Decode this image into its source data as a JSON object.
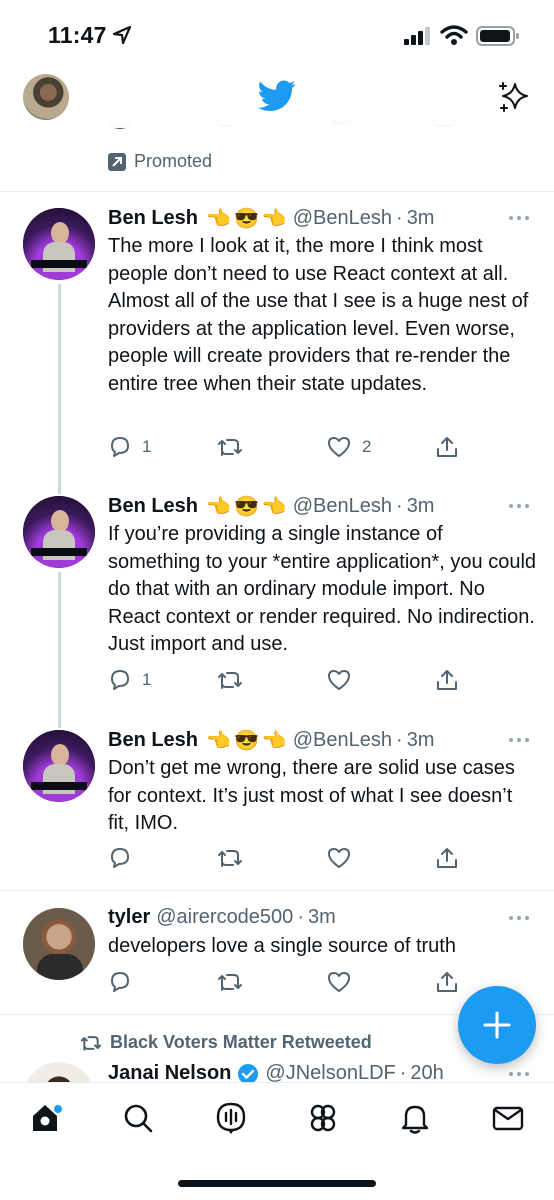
{
  "status": {
    "time": "11:47"
  },
  "promoted_label": "Promoted",
  "tweets": [
    {
      "name": "Ben Lesh",
      "emojis": [
        "👈",
        "😎",
        "👈"
      ],
      "handle": "@BenLesh",
      "time": "3m",
      "text": "The more I look at it, the more I think most people don’t need to use React context at all. Almost all of the use that I see is a huge nest of providers at the application level. Even worse, people will create providers that re-render the entire tree when their state updates.",
      "replies": "1",
      "retweets": "",
      "likes": "2"
    },
    {
      "name": "Ben Lesh",
      "emojis": [
        "👈",
        "😎",
        "👈"
      ],
      "handle": "@BenLesh",
      "time": "3m",
      "text": "If you’re providing a single instance of something to your *entire application*, you could do that with an ordinary module import. No React context or render required. No indirection. Just import and use.",
      "replies": "1",
      "retweets": "",
      "likes": ""
    },
    {
      "name": "Ben Lesh",
      "emojis": [
        "👈",
        "😎",
        "👈"
      ],
      "handle": "@BenLesh",
      "time": "3m",
      "text": "Don’t get me wrong, there are solid use cases for context. It’s just most of what I see doesn’t fit, IMO.",
      "replies": "",
      "retweets": "",
      "likes": ""
    },
    {
      "name": "tyler",
      "handle": "@airercode500",
      "time": "3m",
      "text": "developers love a single source of truth",
      "replies": "",
      "retweets": "",
      "likes": ""
    }
  ],
  "retweet": {
    "label": "Black Voters Matter Retweeted",
    "name": "Janai Nelson",
    "handle": "@JNelsonLDF",
    "time": "20h"
  },
  "colors": {
    "accent": "#1d9bf0",
    "muted": "#536471",
    "text": "#0f1419"
  },
  "icons": [
    "location-arrow-icon",
    "signal-icon",
    "wifi-icon",
    "battery-icon",
    "twitter-bird-icon",
    "sparkle-icon",
    "reply-icon",
    "retweet-icon",
    "like-icon",
    "share-icon",
    "more-icon",
    "compose-plus-icon",
    "home-icon",
    "search-icon",
    "spaces-icon",
    "communities-icon",
    "notifications-icon",
    "messages-icon",
    "verified-icon"
  ]
}
